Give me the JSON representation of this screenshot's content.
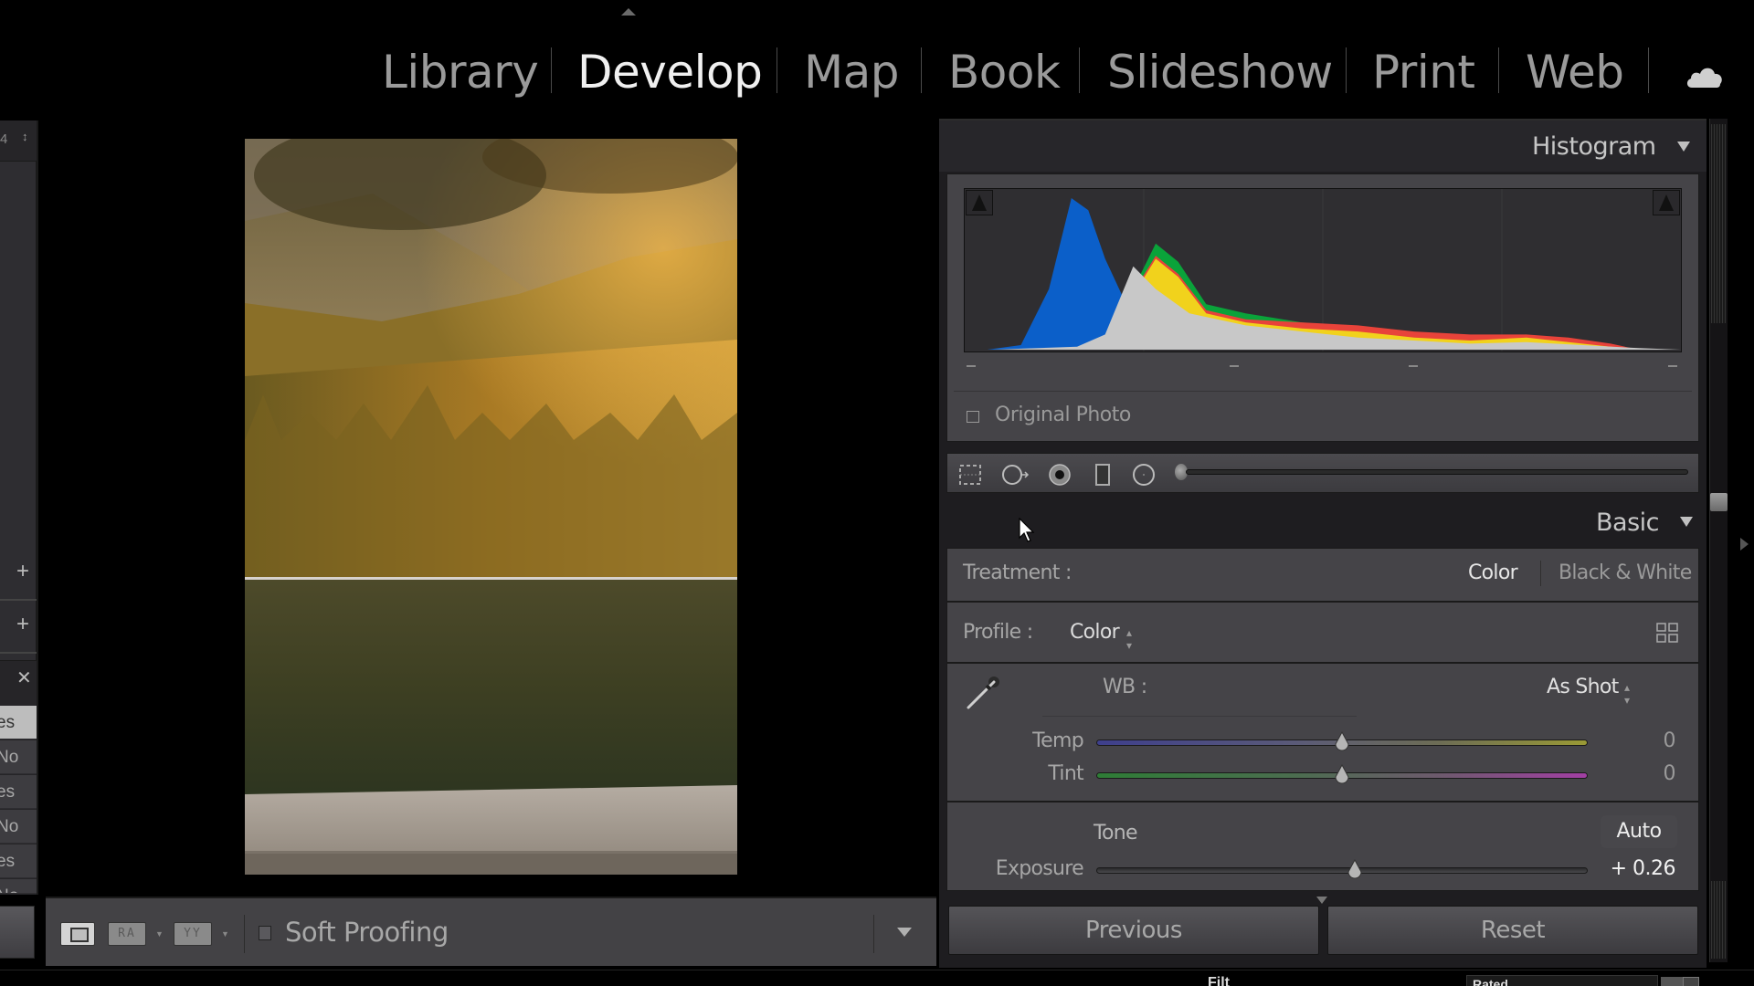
{
  "modules": {
    "items": [
      {
        "label": "Library",
        "active": false
      },
      {
        "label": "Develop",
        "active": true
      },
      {
        "label": "Map",
        "active": false
      },
      {
        "label": "Book",
        "active": false
      },
      {
        "label": "Slideshow",
        "active": false
      },
      {
        "label": "Print",
        "active": false
      },
      {
        "label": "Web",
        "active": false
      }
    ],
    "cloud_icon": "cloud-icon",
    "collapse_icon": "triangle-up-icon"
  },
  "left_panel": {
    "top_value": "4",
    "list_values": [
      "es",
      "No",
      "es",
      "No",
      "es",
      "No"
    ],
    "selected_index": 0,
    "icons": [
      "plus-icon",
      "plus-icon",
      "close-icon"
    ]
  },
  "center": {
    "toolbar": {
      "loupe_icon": "loupe-view-icon",
      "before_after_1": "RA",
      "before_after_2": "YY",
      "soft_proofing_label": "Soft Proofing",
      "soft_proofing_checked": false
    }
  },
  "histogram": {
    "title": "Histogram",
    "original_photo_label": "Original Photo",
    "original_photo_checked": false
  },
  "basic": {
    "title": "Basic",
    "treatment": {
      "label": "Treatment :",
      "options": [
        "Color",
        "Black & White"
      ],
      "selected": "Color"
    },
    "profile": {
      "label": "Profile :",
      "value": "Color"
    },
    "wb": {
      "label": "WB :",
      "value": "As Shot"
    },
    "temp": {
      "label": "Temp",
      "value": "0",
      "position": 0.5
    },
    "tint": {
      "label": "Tint",
      "value": "0",
      "position": 0.5
    },
    "tone": {
      "label": "Tone",
      "auto_label": "Auto"
    },
    "exposure": {
      "label": "Exposure",
      "value": "+ 0.26",
      "position": 0.526
    }
  },
  "buttons": {
    "previous": "Previous",
    "reset": "Reset"
  },
  "filmstrip": {
    "filter_partial": "Filt",
    "select_partial": "Rated"
  },
  "chart_data": {
    "type": "area",
    "title": "Histogram",
    "xlabel": "",
    "ylabel": "",
    "x_range": [
      0,
      255
    ],
    "series": [
      {
        "name": "blue",
        "color": "#0b5fc9",
        "points": [
          [
            8,
            0
          ],
          [
            20,
            3
          ],
          [
            30,
            40
          ],
          [
            38,
            100
          ],
          [
            44,
            92
          ],
          [
            50,
            60
          ],
          [
            56,
            36
          ],
          [
            62,
            10
          ],
          [
            70,
            2
          ],
          [
            80,
            0
          ]
        ]
      },
      {
        "name": "green",
        "color": "#0aa33a",
        "points": [
          [
            55,
            0
          ],
          [
            60,
            40
          ],
          [
            68,
            70
          ],
          [
            76,
            58
          ],
          [
            86,
            30
          ],
          [
            100,
            24
          ],
          [
            120,
            18
          ],
          [
            140,
            14
          ],
          [
            160,
            10
          ],
          [
            180,
            8
          ],
          [
            200,
            10
          ],
          [
            215,
            6
          ],
          [
            230,
            2
          ],
          [
            240,
            0
          ]
        ]
      },
      {
        "name": "red",
        "color": "#e8433a",
        "points": [
          [
            55,
            0
          ],
          [
            60,
            38
          ],
          [
            68,
            62
          ],
          [
            76,
            50
          ],
          [
            86,
            26
          ],
          [
            100,
            20
          ],
          [
            120,
            18
          ],
          [
            140,
            16
          ],
          [
            160,
            12
          ],
          [
            180,
            10
          ],
          [
            200,
            10
          ],
          [
            215,
            8
          ],
          [
            230,
            4
          ],
          [
            240,
            0
          ]
        ]
      },
      {
        "name": "yellow",
        "color": "#f1d21c",
        "points": [
          [
            55,
            0
          ],
          [
            60,
            36
          ],
          [
            68,
            60
          ],
          [
            76,
            48
          ],
          [
            86,
            24
          ],
          [
            100,
            18
          ],
          [
            120,
            14
          ],
          [
            140,
            12
          ],
          [
            160,
            8
          ],
          [
            180,
            6
          ],
          [
            200,
            8
          ],
          [
            215,
            5
          ],
          [
            230,
            2
          ],
          [
            240,
            0
          ]
        ]
      },
      {
        "name": "luminance",
        "color": "#c8c8c8",
        "points": [
          [
            10,
            0
          ],
          [
            40,
            2
          ],
          [
            50,
            10
          ],
          [
            60,
            55
          ],
          [
            68,
            40
          ],
          [
            80,
            24
          ],
          [
            100,
            16
          ],
          [
            120,
            12
          ],
          [
            140,
            8
          ],
          [
            160,
            6
          ],
          [
            180,
            4
          ],
          [
            200,
            5
          ],
          [
            220,
            3
          ],
          [
            240,
            1
          ],
          [
            255,
            0
          ]
        ]
      }
    ]
  }
}
